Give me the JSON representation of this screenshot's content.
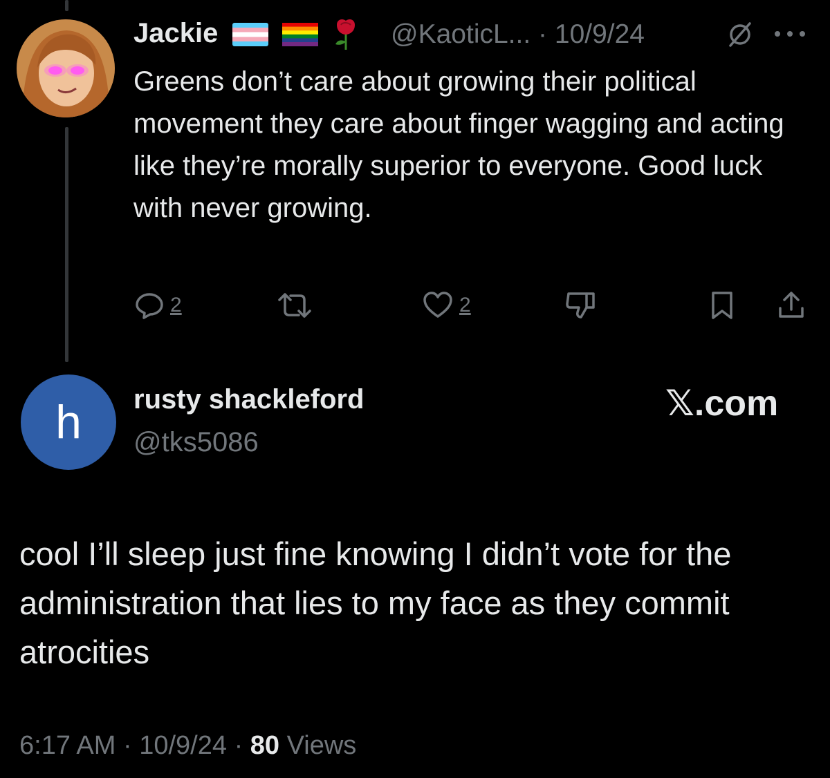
{
  "parent_tweet": {
    "author_name": "Jackie",
    "emojis": [
      "transgender-flag",
      "rainbow-flag",
      "rose"
    ],
    "handle": "@KaoticL...",
    "separator": "·",
    "date": "10/9/24",
    "text": "Greens don’t care about growing their political movement they care about finger wagging and acting like they’re morally superior to everyone. Good luck with never growing.",
    "actions": {
      "reply_count": "2",
      "like_count": "2"
    }
  },
  "reply_tweet": {
    "avatar_letter": "h",
    "author_name": "rusty shackleford",
    "handle": "@tks5086",
    "watermark": "𝕏.com",
    "text": "cool I’ll sleep just fine knowing I didn’t vote for the administration that lies to my face as they commit atrocities",
    "time": "6:17 AM",
    "date": "10/9/24",
    "views_count": "80",
    "views_label": "Views"
  },
  "colors": {
    "background": "#000000",
    "text_primary": "#e7e9ea",
    "text_secondary": "#71767b",
    "thread_line": "#333639",
    "avatar2_bg": "#2f5ea8"
  }
}
